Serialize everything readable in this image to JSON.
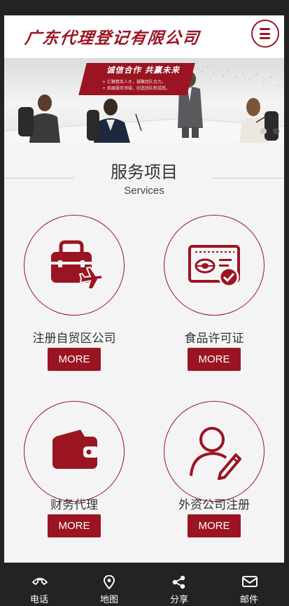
{
  "header": {
    "logo_text": "广东代理登记有限公司",
    "menu_icon": "menu-icon"
  },
  "banner": {
    "slogan": "诚信合作  共赢未来",
    "slogan_lines": [
      "+ 汇聚精英人才，凝聚团队合力，",
      "+ 拓展服务领域，创造团队新成就。"
    ],
    "active_slide": 1,
    "slide_count": 2
  },
  "section": {
    "title": "服务项目",
    "subtitle": "Services"
  },
  "services": [
    {
      "label": "注册自贸区公司",
      "more": "MORE",
      "icon": "briefcase-plane-icon"
    },
    {
      "label": "食品许可证",
      "more": "MORE",
      "icon": "license-card-icon"
    },
    {
      "label": "财务代理",
      "more": "MORE",
      "icon": "wallet-icon"
    },
    {
      "label": "外资公司注册",
      "more": "MORE",
      "icon": "user-edit-icon"
    }
  ],
  "footer": [
    {
      "label": "电话",
      "icon": "phone-icon"
    },
    {
      "label": "地图",
      "icon": "map-pin-icon"
    },
    {
      "label": "分享",
      "icon": "share-icon"
    },
    {
      "label": "邮件",
      "icon": "mail-icon"
    }
  ],
  "colors": {
    "accent": "#9b1422",
    "footer_bg": "#232323",
    "content_bg": "#f4f4f4"
  }
}
